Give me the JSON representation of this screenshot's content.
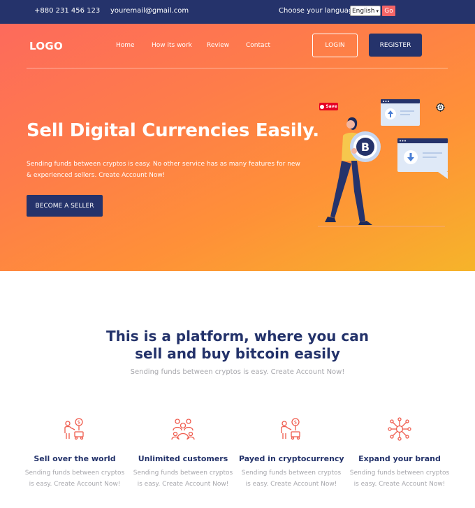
{
  "topbar": {
    "phone": "+880 231 456 123",
    "email": "youremail@gmail.com",
    "language_label": "Choose your language",
    "language_selected": "English",
    "go_label": "Go"
  },
  "header": {
    "logo": "LOGO",
    "nav": [
      {
        "label": "Home"
      },
      {
        "label": "How its work"
      },
      {
        "label": "Review"
      },
      {
        "label": "Contact"
      }
    ],
    "login_label": "LOGIN",
    "register_label": "REGISTER"
  },
  "hero": {
    "title": "Sell Digital Currencies Easily.",
    "description": "Sending funds between cryptos is easy. No other service has as many features for new & experienced sellers. Create Account Now!",
    "cta_label": "BECOME A SELLER",
    "save_label": "Save"
  },
  "platform": {
    "title_line1": "This is a platform, where you can",
    "title_line2": "sell and buy bitcoin easily",
    "subtitle": "Sending funds between cryptos is easy. Create Account Now!"
  },
  "features": [
    {
      "title": "Sell over the world",
      "description": "Sending funds between cryptos is easy. Create Account Now!",
      "icon": "seller-coin-icon"
    },
    {
      "title": "Unlimited customers",
      "description": "Sending funds between cryptos is easy. Create Account Now!",
      "icon": "customers-group-icon"
    },
    {
      "title": "Payed in cryptocurrency",
      "description": "Sending funds between cryptos is easy. Create Account Now!",
      "icon": "seller-coin-icon"
    },
    {
      "title": "Expand your brand",
      "description": "Sending funds between cryptos is easy. Create Account Now!",
      "icon": "network-icon"
    }
  ],
  "colors": {
    "navy": "#25336b",
    "accent": "#f46567",
    "gradient_start": "#fd6a5c",
    "gradient_end": "#f6b42a",
    "muted_text": "#a7a7ac",
    "icon_stroke": "#ef5a4c"
  }
}
